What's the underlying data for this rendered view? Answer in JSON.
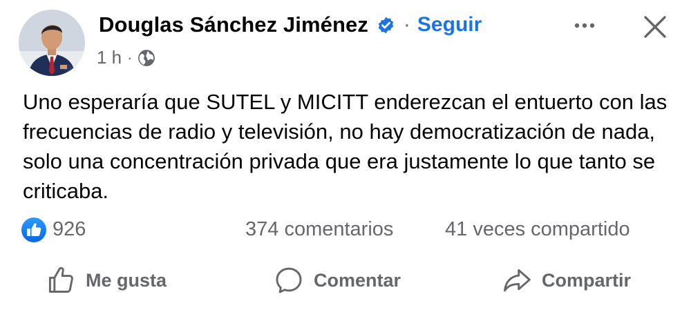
{
  "post": {
    "author": "Douglas Sánchez Jiménez",
    "follow_label": "Seguir",
    "separator": "·",
    "time": "1 h",
    "meta_separator": "·",
    "text": "Uno esperaría que SUTEL y MICITT enderezcan el entuerto con las frecuencias de radio y televisión, no hay democratización de nada, solo una concentración privada que era justamente lo que tanto se criticaba."
  },
  "stats": {
    "likes": "926",
    "comments": "374 comentarios",
    "shares": "41 veces compartido"
  },
  "actions": {
    "like_label": "Me gusta",
    "comment_label": "Comentar",
    "share_label": "Compartir"
  },
  "colors": {
    "accent": "#1b74e4",
    "secondary_text": "#65676b",
    "text": "#050505"
  },
  "icons": {
    "audience": "globe-icon",
    "verified": "verified-badge-icon",
    "more": "more-options-icon",
    "close": "close-icon",
    "like_reaction": "thumbs-up-icon",
    "comment": "speech-bubble-icon",
    "share": "share-arrow-icon"
  }
}
